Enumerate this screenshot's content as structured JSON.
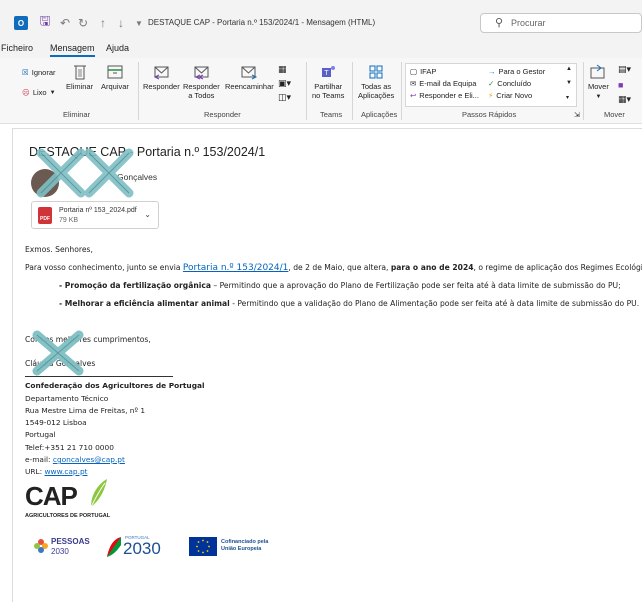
{
  "titlebar": {
    "title": "DESTAQUE CAP - Portaria n.º 153/2024/1  -  Mensagem (HTML)",
    "search_placeholder": "Procurar",
    "icons": [
      "outlook-icon",
      "save-icon",
      "undo-icon",
      "redo-icon",
      "up-arrow-icon",
      "down-arrow-icon"
    ]
  },
  "menu": {
    "tabs": [
      "Ficheiro",
      "Mensagem",
      "Ajuda"
    ],
    "active": "Mensagem"
  },
  "ribbon": {
    "delete_group": {
      "ignore": "Ignorar",
      "junk": "Lixo",
      "delete": "Eliminar",
      "archive": "Arquivar",
      "label": "Eliminar"
    },
    "respond_group": {
      "reply": "Responder",
      "reply_all_1": "Responder",
      "reply_all_2": "a Todos",
      "forward": "Reencaminhar",
      "label": "Responder"
    },
    "teams_group": {
      "share_1": "Partilhar",
      "share_2": "no Teams",
      "label": "Teams"
    },
    "apps_group": {
      "all_1": "Todas as",
      "all_2": "Aplicações",
      "label": "Aplicações"
    },
    "quick_steps": {
      "items": [
        "IFAP",
        "Para o Gestor",
        "E-mail da Equipa",
        "Concluído",
        "Responder e Eli...",
        "Criar Novo"
      ],
      "label": "Passos Rápidos"
    },
    "move_group": {
      "move": "Mover",
      "label": "Mover"
    }
  },
  "message": {
    "subject": "DESTAQUE CAP - Portaria n.º 153/2024/1",
    "sender_partial": "Gonçalves",
    "attachment": {
      "name": "Portaria nº 153_2024.pdf",
      "size": "79 KB"
    },
    "greeting": "Exmos. Senhores,",
    "intro_1": "Para vosso conhecimento, junto se envia",
    "intro_link": "Portaria n.º 153/2024/1",
    "intro_2": ", de 2 de Maio, que altera,",
    "intro_bold": "para o ano de 2024",
    "intro_3": ", o regime de aplicação dos Regimes Ecológicos:",
    "bullet1_bold": "- Promoção da fertilização orgânica",
    "bullet1_text": " – Permitindo que a aprovação do Plano de Fertilização pode ser feita até à data limite de submissão do PU;",
    "bullet2_bold": "- Melhorar a eficiência alimentar animal",
    "bullet2_text": " - Permitindo que a validação do Plano de Alimentação pode ser feita até à data limite de submissão do PU.",
    "closing": "Com os melhores cumprimentos,",
    "signer_partial": "Cláudia Gonçalves"
  },
  "signature": {
    "org": "Confederação dos Agricultores de Portugal",
    "dept": "Departamento Técnico",
    "street": "Rua Mestre Lima de Freitas, nº 1",
    "postal": "1549-012 Lisboa",
    "country": "Portugal",
    "phone": "Telef:+351 21 710 0000",
    "email_label": "e-mail: ",
    "email": "cgoncalves@cap.pt",
    "url_label": "URL: ",
    "url": "www.cap.pt",
    "logo_word": "CAP",
    "logo_sub": "AGRICULTORES DE PORTUGAL",
    "footer_pessoas": "PESSOAS",
    "footer_pessoas_year": "2030",
    "footer_portugal_small": "PORTUGAL",
    "footer_portugal_year": "2030",
    "footer_eu_1": "Cofinanciado pela",
    "footer_eu_2": "União Europeia"
  },
  "colors": {
    "accent": "#0f6cbd",
    "link": "#0563c1",
    "pdf_red": "#d13438",
    "cap_green": "#8dc63f",
    "redaction_x": "#7fbfc4",
    "eu_blue": "#003399"
  }
}
